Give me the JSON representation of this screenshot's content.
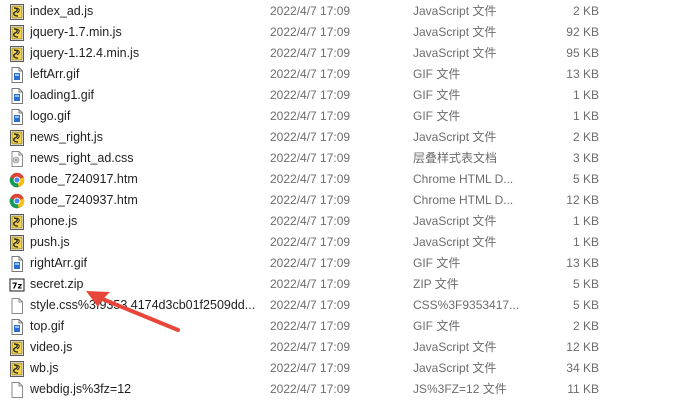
{
  "colors": {
    "arrow": "#e8463a",
    "hover_row": "#e5f3ff"
  },
  "files": [
    {
      "name": "index_ad.js",
      "date": "2022/4/7 17:09",
      "type": "JavaScript 文件",
      "size": "2 KB",
      "icon": "js-file-icon"
    },
    {
      "name": "jquery-1.7.min.js",
      "date": "2022/4/7 17:09",
      "type": "JavaScript 文件",
      "size": "92 KB",
      "icon": "js-file-icon"
    },
    {
      "name": "jquery-1.12.4.min.js",
      "date": "2022/4/7 17:09",
      "type": "JavaScript 文件",
      "size": "95 KB",
      "icon": "js-file-icon"
    },
    {
      "name": "leftArr.gif",
      "date": "2022/4/7 17:09",
      "type": "GIF 文件",
      "size": "13 KB",
      "icon": "image-file-icon"
    },
    {
      "name": "loading1.gif",
      "date": "2022/4/7 17:09",
      "type": "GIF 文件",
      "size": "1 KB",
      "icon": "image-file-icon"
    },
    {
      "name": "logo.gif",
      "date": "2022/4/7 17:09",
      "type": "GIF 文件",
      "size": "1 KB",
      "icon": "image-file-icon"
    },
    {
      "name": "news_right.js",
      "date": "2022/4/7 17:09",
      "type": "JavaScript 文件",
      "size": "2 KB",
      "icon": "js-file-icon"
    },
    {
      "name": "news_right_ad.css",
      "date": "2022/4/7 17:09",
      "type": "层叠样式表文档",
      "size": "3 KB",
      "icon": "css-file-icon"
    },
    {
      "name": "node_7240917.htm",
      "date": "2022/4/7 17:09",
      "type": "Chrome HTML D...",
      "size": "5 KB",
      "icon": "chrome-icon"
    },
    {
      "name": "node_7240937.htm",
      "date": "2022/4/7 17:09",
      "type": "Chrome HTML D...",
      "size": "12 KB",
      "icon": "chrome-icon"
    },
    {
      "name": "phone.js",
      "date": "2022/4/7 17:09",
      "type": "JavaScript 文件",
      "size": "1 KB",
      "icon": "js-file-icon"
    },
    {
      "name": "push.js",
      "date": "2022/4/7 17:09",
      "type": "JavaScript 文件",
      "size": "1 KB",
      "icon": "js-file-icon"
    },
    {
      "name": "rightArr.gif",
      "date": "2022/4/7 17:09",
      "type": "GIF 文件",
      "size": "13 KB",
      "icon": "image-file-icon"
    },
    {
      "name": "secret.zip",
      "date": "2022/4/7 17:09",
      "type": "ZIP 文件",
      "size": "5 KB",
      "icon": "7zip-icon"
    },
    {
      "name": "style.css%3f9353 4174d3cb01f2509dd...",
      "date": "2022/4/7 17:09",
      "type": "CSS%3F9353417...",
      "size": "5 KB",
      "icon": "blank-file-icon"
    },
    {
      "name": "top.gif",
      "date": "2022/4/7 17:09",
      "type": "GIF 文件",
      "size": "2 KB",
      "icon": "image-file-icon"
    },
    {
      "name": "video.js",
      "date": "2022/4/7 17:09",
      "type": "JavaScript 文件",
      "size": "12 KB",
      "icon": "js-file-icon"
    },
    {
      "name": "wb.js",
      "date": "2022/4/7 17:09",
      "type": "JavaScript 文件",
      "size": "34 KB",
      "icon": "js-file-icon"
    },
    {
      "name": "webdig.js%3fz=12",
      "date": "2022/4/7 17:09",
      "type": "JS%3FZ=12 文件",
      "size": "11 KB",
      "icon": "blank-file-icon"
    }
  ]
}
